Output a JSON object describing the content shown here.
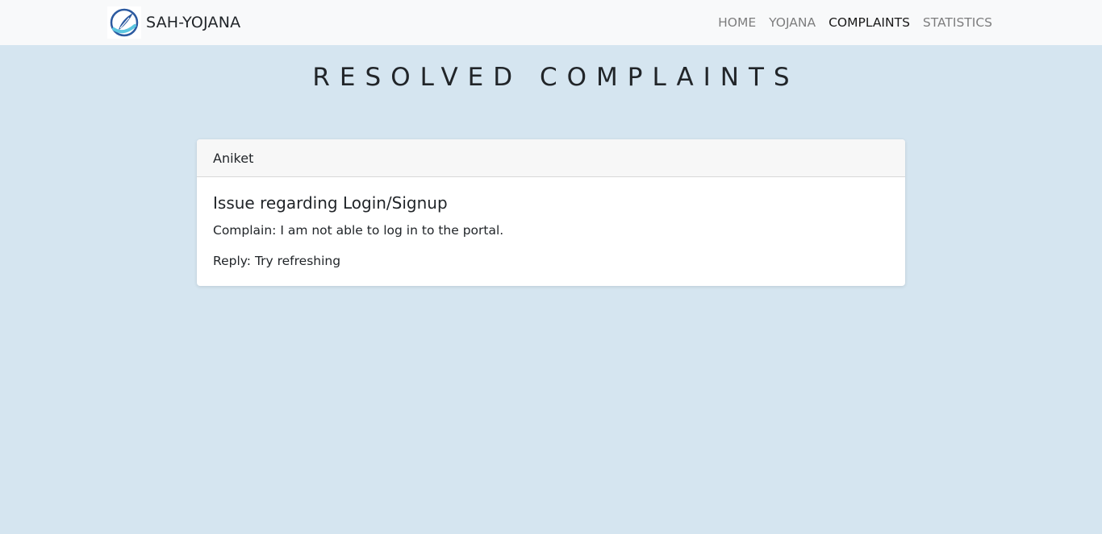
{
  "navbar": {
    "brand_text": "SAH-YOJANA",
    "logo_icon": "feather-quill-logo-icon",
    "links": [
      {
        "label": "HOME",
        "active": false
      },
      {
        "label": "YOJANA",
        "active": false
      },
      {
        "label": "COMPLAINTS",
        "active": true
      },
      {
        "label": "STATISTICS",
        "active": false
      }
    ]
  },
  "main": {
    "title": "RESOLVED COMPLAINTS",
    "complaints": [
      {
        "user": "Aniket",
        "subject": "Issue regarding Login/Signup",
        "complaint": "Complain: I am not able to log in to the portal.",
        "reply": "Reply: Try refreshing"
      }
    ]
  },
  "colors": {
    "page_background": "#d5e5f0",
    "navbar_background": "#f8f9fa",
    "card_header_background": "#f7f7f7",
    "logo_blue": "#2c5aa0",
    "logo_cyan": "#5bc6e0"
  }
}
